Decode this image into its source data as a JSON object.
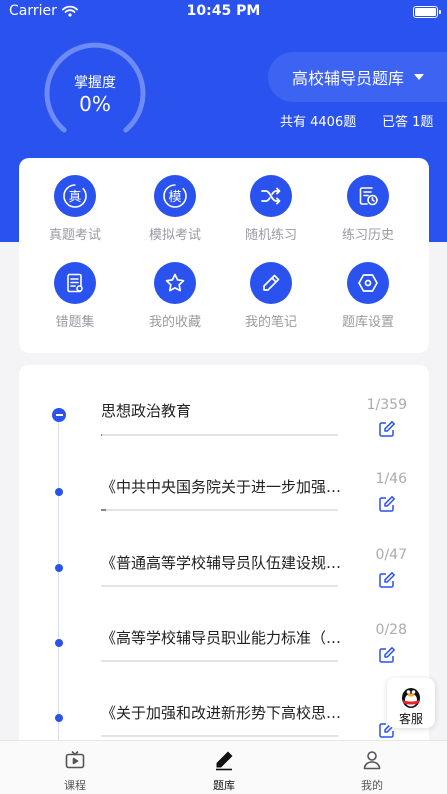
{
  "status_bar": {
    "carrier": "Carrier",
    "time": "10:45 PM"
  },
  "header": {
    "mastery_label": "掌握度",
    "mastery_value": "0%",
    "mastery_fraction": 0,
    "bank_name": "高校辅导员题库",
    "total_questions": "共有 4406题",
    "answered_questions": "已答 1题"
  },
  "features": [
    {
      "label": "真题考试",
      "icon": "real-exam-icon"
    },
    {
      "label": "模拟考试",
      "icon": "mock-exam-icon"
    },
    {
      "label": "随机练习",
      "icon": "shuffle-icon"
    },
    {
      "label": "练习历史",
      "icon": "history-icon"
    },
    {
      "label": "错题集",
      "icon": "wrong-questions-icon"
    },
    {
      "label": "我的收藏",
      "icon": "star-icon"
    },
    {
      "label": "我的笔记",
      "icon": "pencil-icon"
    },
    {
      "label": "题库设置",
      "icon": "settings-hex-icon"
    }
  ],
  "feature_glyphs": {
    "real": "真",
    "mock": "模"
  },
  "chapters": [
    {
      "title": "思想政治教育",
      "progress": "1/359",
      "fraction": 0.003
    },
    {
      "title": "《中共中央国务院关于进一步加强和改进大学生思想政治教育的意见》",
      "progress": "1/46",
      "fraction": 0.022
    },
    {
      "title": "《普通高等学校辅导员队伍建设规定》",
      "progress": "0/47",
      "fraction": 0
    },
    {
      "title": "《高等学校辅导员职业能力标准（暂行）》",
      "progress": "0/28",
      "fraction": 0
    },
    {
      "title": "《关于加强和改进新形势下高校思想政治工作的意见》",
      "progress": "0/",
      "fraction": 0
    }
  ],
  "kefu": {
    "label": "客服"
  },
  "tabbar": [
    {
      "label": "课程",
      "icon": "tv-icon",
      "active": false
    },
    {
      "label": "题库",
      "icon": "pen-icon",
      "active": true
    },
    {
      "label": "我的",
      "icon": "user-icon",
      "active": false
    }
  ],
  "colors": {
    "primary": "#2a52ee",
    "background": "#f4f4f6",
    "label_gray": "#9a9aa2"
  }
}
